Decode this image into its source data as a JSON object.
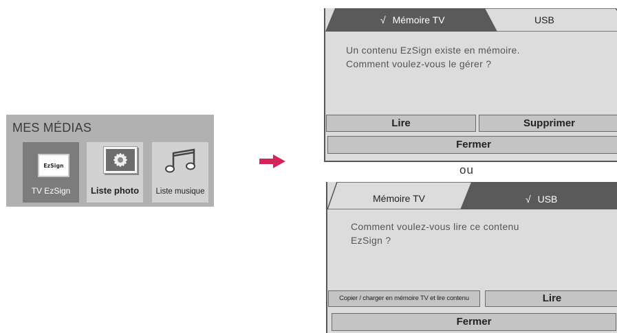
{
  "mes_medias": {
    "title": "MES MÉDIAS",
    "tiles": [
      {
        "label": "TV EzSign",
        "icon": "ezsign-logo-icon",
        "logo_text": "EzSign"
      },
      {
        "label": "Liste photo",
        "icon": "photo-flower-icon"
      },
      {
        "label": "Liste musique",
        "icon": "music-note-icon"
      }
    ]
  },
  "arrow": {
    "icon": "right-arrow-icon",
    "color": "#d6245a"
  },
  "separator": "ou",
  "dialog_tv": {
    "tabs": [
      {
        "label": "Mémoire TV",
        "check": "√",
        "selected": true
      },
      {
        "label": "USB",
        "selected": false
      }
    ],
    "message_line1": "Un contenu EzSign existe en mémoire.",
    "message_line2": "Comment voulez-vous le gérer ?",
    "buttons": {
      "play": "Lire",
      "delete": "Supprimer",
      "close": "Fermer"
    }
  },
  "dialog_usb": {
    "tabs": [
      {
        "label": "Mémoire TV",
        "selected": false
      },
      {
        "label": "USB",
        "check": "√",
        "selected": true
      }
    ],
    "message_line1": "Comment voulez-vous lire ce contenu",
    "message_line2": "EzSign ?",
    "buttons": {
      "copy": "Copier / charger en mémoire TV et lire contenu",
      "play": "Lire",
      "close": "Fermer"
    }
  },
  "colors": {
    "panel_bg": "#b1b1b1",
    "selected_tile": "#7c7c7c",
    "tab_active": "#5a5a5a",
    "dialog_bg": "#dcdcdc",
    "button_bg": "#c4c4c4"
  }
}
